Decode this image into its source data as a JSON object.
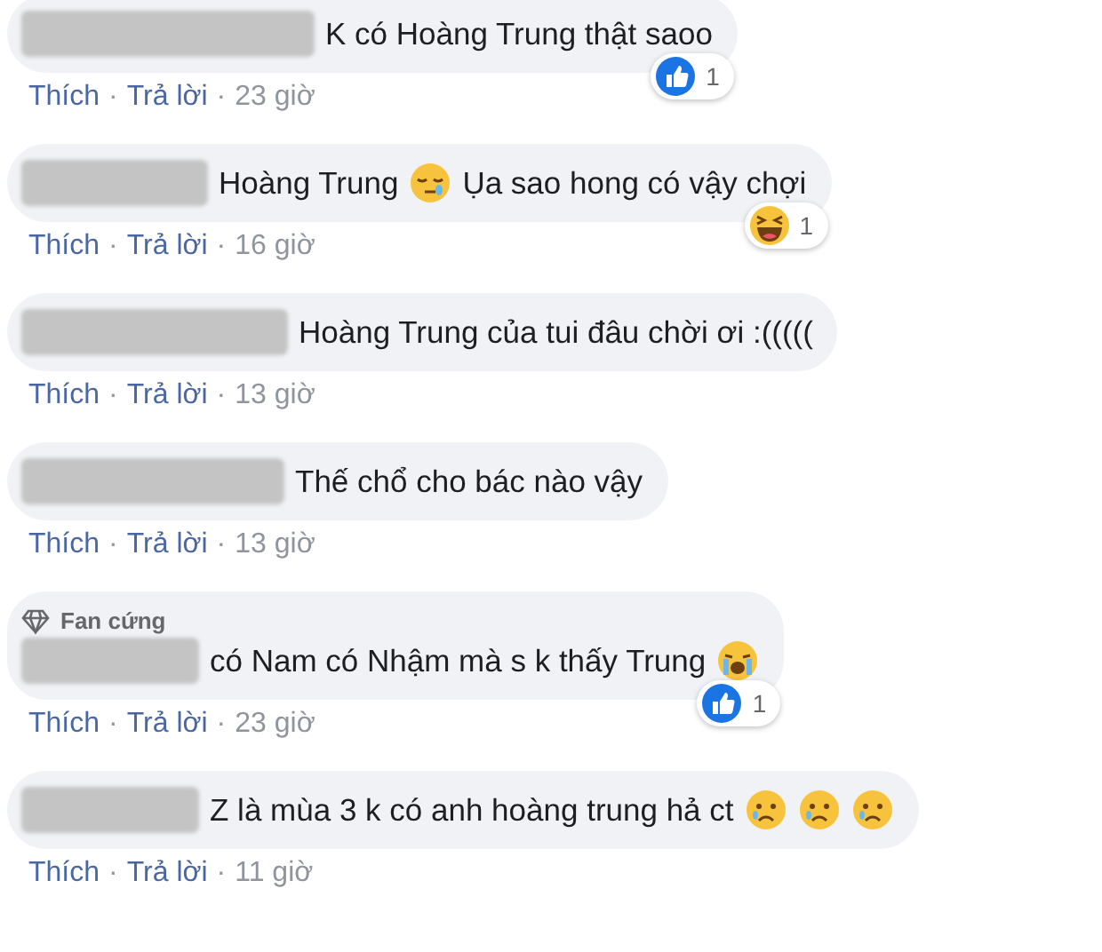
{
  "comments": [
    {
      "body": [
        {
          "kind": "text",
          "text": "K có Hoàng Trung thật saoo"
        }
      ],
      "reaction": {
        "kind": "like",
        "count": "1"
      },
      "actions": {
        "like": "Thích",
        "sep_1": "·",
        "reply": "Trả lời",
        "sep_2": "·",
        "time": "23 giờ"
      }
    },
    {
      "body": [
        {
          "kind": "text",
          "text": "Hoàng Trung"
        },
        {
          "kind": "sleepy"
        },
        {
          "kind": "text",
          "text": "Ụa sao hong có vậy chợi"
        }
      ],
      "reaction": {
        "kind": "haha",
        "count": "1"
      },
      "actions": {
        "like": "Thích",
        "sep_1": "·",
        "reply": "Trả lời",
        "sep_2": "·",
        "time": "16 giờ"
      }
    },
    {
      "body": [
        {
          "kind": "text",
          "text": "Hoàng Trung của tui đâu chời ơi :((((("
        }
      ],
      "actions": {
        "like": "Thích",
        "sep_1": "·",
        "reply": "Trả lời",
        "sep_2": "·",
        "time": "13 giờ"
      }
    },
    {
      "body": [
        {
          "kind": "text",
          "text": "Thế chổ cho bác nào vậy"
        }
      ],
      "actions": {
        "like": "Thích",
        "sep_1": "·",
        "reply": "Trả lời",
        "sep_2": "·",
        "time": "13 giờ"
      }
    },
    {
      "badge": "Fan cứng",
      "body": [
        {
          "kind": "text",
          "text": "có Nam có Nhậm mà s k thấy Trung"
        },
        {
          "kind": "crying"
        }
      ],
      "reaction": {
        "kind": "like",
        "count": "1"
      },
      "actions": {
        "like": "Thích",
        "sep_1": "·",
        "reply": "Trả lời",
        "sep_2": "·",
        "time": "23 giờ"
      }
    },
    {
      "body": [
        {
          "kind": "text",
          "text": "Z là mùa 3 k có anh hoàng trung hả ct"
        },
        {
          "kind": "sad"
        },
        {
          "kind": "sad"
        },
        {
          "kind": "sad"
        }
      ],
      "actions": {
        "like": "Thích",
        "sep_1": "·",
        "reply": "Trả lời",
        "sep_2": "·",
        "time": "11 giờ"
      }
    }
  ]
}
